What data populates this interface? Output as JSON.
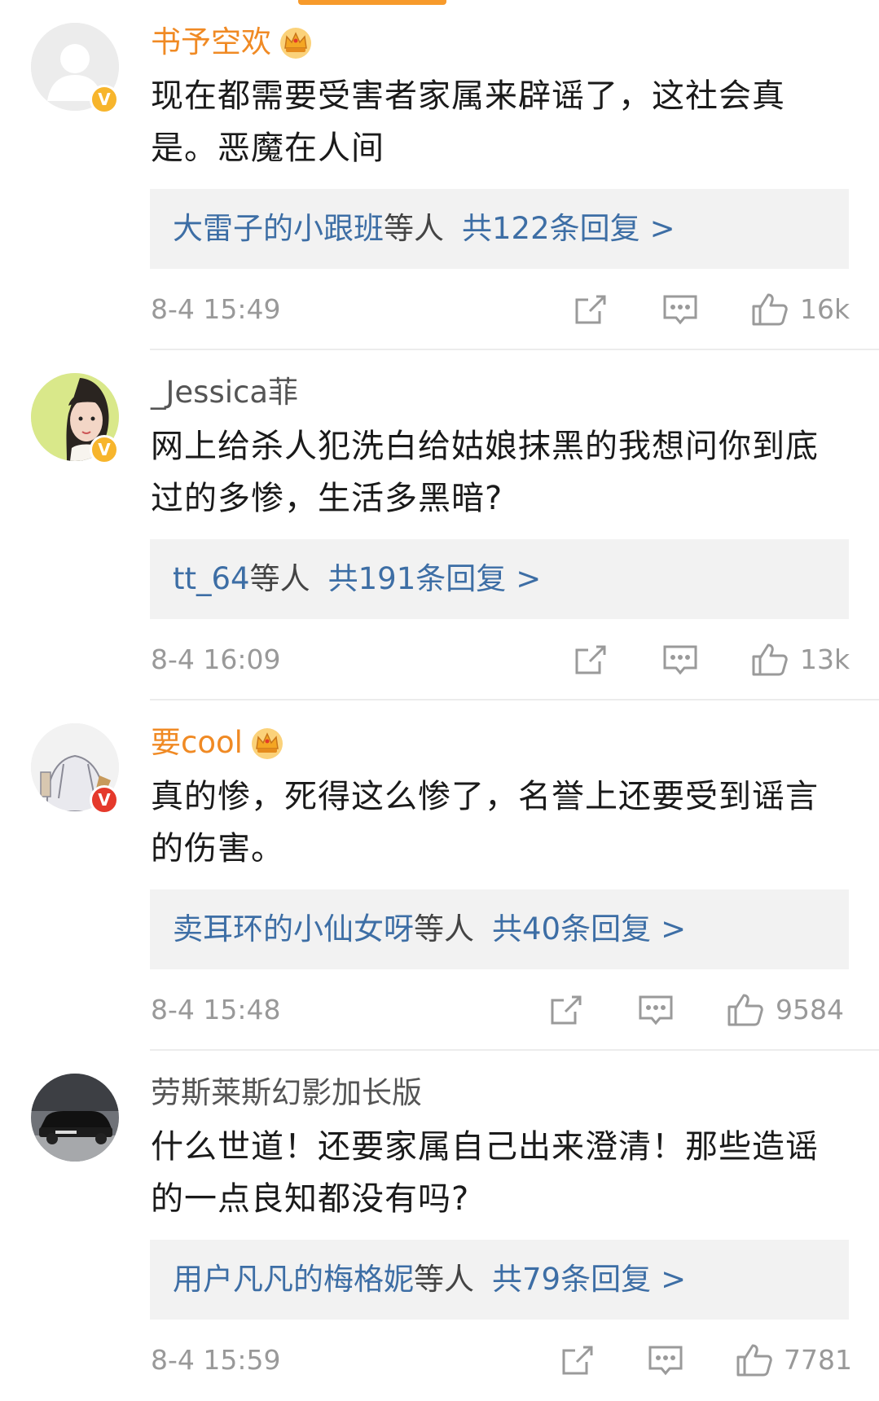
{
  "theme": {
    "accent_orange": "#f79a2b",
    "link_blue": "#3d6ea5",
    "vip_name_color": "#f08a24",
    "normal_name_color": "#555555",
    "badge_yellow": "#f7b52c",
    "badge_red": "#e5392b"
  },
  "comments": [
    {
      "username": "书予空欢",
      "name_style": "vip",
      "has_crown": true,
      "badge": "V",
      "badge_color": "yellow",
      "avatar_icon": "default-user-avatar",
      "content": "现在都需要受害者家属来辟谣了，这社会真是。恶魔在人间",
      "repliers": "大雷子的小跟班",
      "repliers_suffix": "等人",
      "reply_count": "共122条回复",
      "chevron": ">",
      "time": "8-4 15:49",
      "likes": "16k"
    },
    {
      "username": "_Jessica菲",
      "name_style": "normal",
      "has_crown": false,
      "badge": "V",
      "badge_color": "yellow",
      "avatar_icon": "girl-photo-avatar",
      "content": "网上给杀人犯洗白给姑娘抹黑的我想问你到底过的多惨，生活多黑暗?",
      "repliers": "tt_64",
      "repliers_suffix": "等人",
      "reply_count": "共191条回复",
      "chevron": ">",
      "time": "8-4 16:09",
      "likes": "13k"
    },
    {
      "username": "要cool",
      "name_style": "vip",
      "has_crown": true,
      "badge": "V",
      "badge_color": "red",
      "avatar_icon": "sketch-person-avatar",
      "content": "真的惨，死得这么惨了，名誉上还要受到谣言的伤害。",
      "repliers": "卖耳环的小仙女呀",
      "repliers_suffix": "等人",
      "reply_count": "共40条回复",
      "chevron": ">",
      "time": "8-4 15:48",
      "likes": "9584"
    },
    {
      "username": "劳斯莱斯幻影加长版",
      "name_style": "normal",
      "has_crown": false,
      "badge": "",
      "badge_color": "",
      "avatar_icon": "car-photo-avatar",
      "content": "什么世道！还要家属自己出来澄清！那些造谣的一点良知都没有吗?",
      "repliers": "用户凡凡的梅格妮",
      "repliers_suffix": "等人",
      "reply_count": "共79条回复",
      "chevron": ">",
      "time": "8-4 15:59",
      "likes": "7781"
    }
  ]
}
